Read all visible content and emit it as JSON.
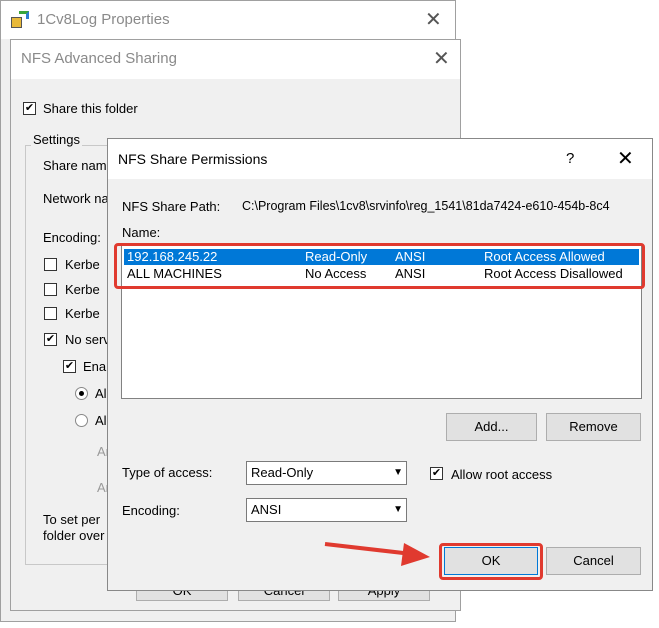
{
  "properties_window": {
    "title": "1Cv8Log Properties",
    "buttons": {
      "ok": "OK",
      "cancel": "Cancel",
      "apply": "Apply"
    }
  },
  "advanced_sharing": {
    "title": "NFS Advanced Sharing",
    "share_this_folder": {
      "label": "Share this folder",
      "checked": true
    },
    "settings_group": "Settings",
    "share_name_label": "Share nam",
    "network_name_label": "Network na",
    "encoding_label": "Encoding:",
    "checkboxes": [
      {
        "label": "Kerbe",
        "checked": false
      },
      {
        "label": "Kerbe",
        "checked": false
      },
      {
        "label": "Kerbe",
        "checked": false
      },
      {
        "label": "No serv",
        "checked": true
      }
    ],
    "enable": {
      "label": "Ena",
      "checked": true
    },
    "radios": [
      {
        "label": "Al",
        "checked": true
      },
      {
        "label": "Al",
        "checked": false
      }
    ],
    "disabled_labels": [
      "An",
      "An"
    ],
    "permissions_note": [
      "To set per",
      "folder over"
    ]
  },
  "permissions_dialog": {
    "title": "NFS Share Permissions",
    "help": "?",
    "share_path_label": "NFS Share Path:",
    "share_path": "C:\\Program Files\\1cv8\\srvinfo\\reg_1541\\81da7424-e610-454b-8c4",
    "name_label": "Name:",
    "entries": [
      {
        "name": "192.168.245.22",
        "access": "Read-Only",
        "encoding": "ANSI",
        "root": "Root Access Allowed",
        "selected": true
      },
      {
        "name": "ALL MACHINES",
        "access": "No Access",
        "encoding": "ANSI",
        "root": "Root Access Disallowed",
        "selected": false
      }
    ],
    "add_button": "Add...",
    "remove_button": "Remove",
    "type_of_access_label": "Type of access:",
    "type_of_access_value": "Read-Only",
    "allow_root": {
      "label": "Allow root access",
      "checked": true
    },
    "encoding_label": "Encoding:",
    "encoding_value": "ANSI",
    "ok_button": "OK",
    "cancel_button": "Cancel"
  },
  "colors": {
    "selection": "#0078d7",
    "annotation": "#e03a2f"
  }
}
